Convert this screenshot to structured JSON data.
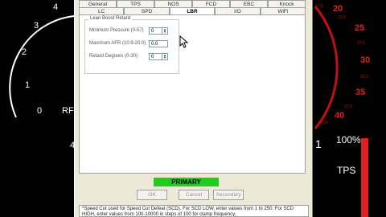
{
  "dialog": {
    "tabs_row1": [
      "General",
      "TPS",
      "NOS",
      "FCD",
      "EBC",
      "Knock"
    ],
    "tabs_row2": [
      "LC",
      "SPD",
      "LBR",
      "I/O",
      "WiFi"
    ],
    "active_tab": "LBR",
    "group": {
      "title": "Lean Boost Retard",
      "fields": [
        {
          "label": "Minimum Pressure (0-57)",
          "value": "0"
        },
        {
          "label": "Maximum AFR (10.9-20.0)",
          "value": "0.0"
        },
        {
          "label": "Retard Degrees (0-30)",
          "value": "0"
        }
      ]
    },
    "status": "PRIMARY",
    "status_color": "#1FCD1F",
    "buttons": {
      "ok": "OK",
      "cancel": "Cancel",
      "secondary": "Secondary"
    },
    "description": "*Speed Cut used for Speed Cut Defeat (SCD). For SCD LOW, enter values from 1 to 250. For SCD HIGH, enter values from 100-10000 in steps of 100 for clamp frequency."
  },
  "gauge_left": {
    "ticks": [
      "0",
      "1",
      "2",
      "3",
      "4"
    ],
    "unit_fragment": "RF"
  },
  "gauge_right": {
    "ticks": [
      "20",
      "25",
      "30",
      "35",
      "40"
    ],
    "minor_ticks": [
      "17.5",
      "22.5",
      "27.5",
      "32.5",
      "37.5",
      "42.5"
    ],
    "center_fragment": "1"
  },
  "tps": {
    "percent": "100%",
    "label": "TPS",
    "level": 1.0
  },
  "misc_fragment": "4"
}
